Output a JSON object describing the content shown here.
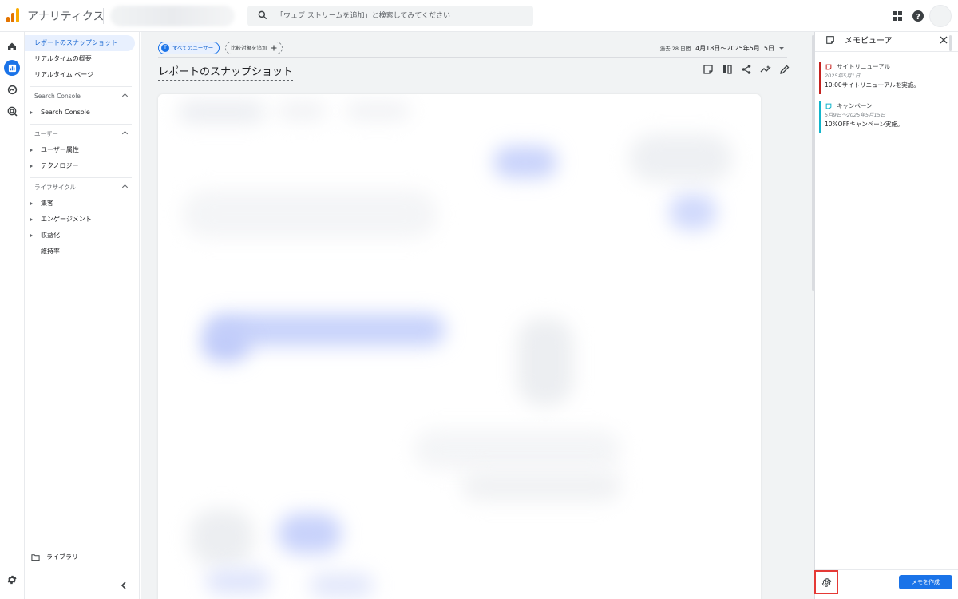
{
  "app": {
    "title": "アナリティクス",
    "search_placeholder": "「ウェブ ストリームを追加」と検索してみてください"
  },
  "colors": {
    "accent": "#1a73e8",
    "logo": [
      "#f9ab00",
      "#e37400",
      "#e37400"
    ],
    "memo_red": "#c5221f",
    "memo_teal": "#12b5cb",
    "highlight": "#e53935"
  },
  "rail": {
    "items": [
      {
        "name": "home-icon"
      },
      {
        "name": "reports-icon"
      },
      {
        "name": "explore-icon"
      },
      {
        "name": "advertising-icon"
      }
    ]
  },
  "nav": {
    "items": [
      {
        "label": "レポートのスナップショット"
      },
      {
        "label": "リアルタイムの概要"
      },
      {
        "label": "リアルタイム ページ"
      }
    ],
    "sections": [
      {
        "label": "Search Console",
        "children": [
          {
            "label": "Search Console"
          }
        ]
      },
      {
        "label": "ユーザー",
        "children": [
          {
            "label": "ユーザー属性"
          },
          {
            "label": "テクノロジー"
          }
        ]
      },
      {
        "label": "ライフサイクル",
        "children": [
          {
            "label": "集客"
          },
          {
            "label": "エンゲージメント"
          },
          {
            "label": "収益化"
          },
          {
            "label": "維持率"
          }
        ]
      }
    ],
    "library_label": "ライブラリ"
  },
  "main": {
    "chip_all_badge": "T",
    "chip_all": "すべてのユーザー",
    "chip_add": "比較対象を追加",
    "date_prefix": "過去 28 日間",
    "date_value": "4月18日～2025年5月15日",
    "page_title": "レポートのスナップショット",
    "toolbar": [
      {
        "name": "memo-icon"
      },
      {
        "name": "compare-icon"
      },
      {
        "name": "share-icon"
      },
      {
        "name": "insights-icon"
      },
      {
        "name": "edit-icon"
      }
    ]
  },
  "memo_panel": {
    "title": "メモビューア",
    "memos": [
      {
        "title": "サイトリニューアル",
        "date": "2025年5月1日",
        "desc": "10:00サイトリニューアルを実施。",
        "color": "#c5221f"
      },
      {
        "title": "キャンペーン",
        "date": "5月9日～2025年5月15日",
        "desc": "10%OFFキャンペーン実施。",
        "color": "#12b5cb"
      }
    ],
    "create_label": "メモを作成"
  }
}
